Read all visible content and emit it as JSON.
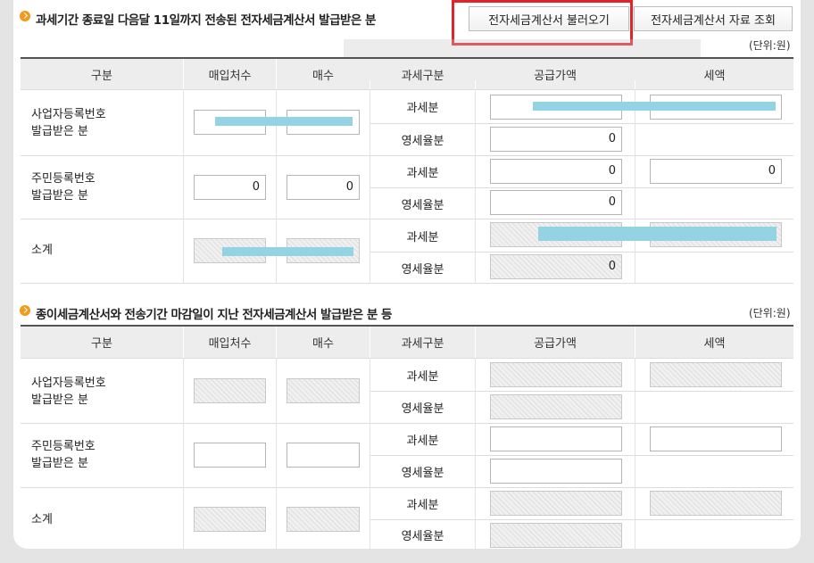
{
  "section1": {
    "title": "과세기간 종료일 다음달 11일까지 전송된 전자세금계산서 발급받은 분",
    "load_button": "전자세금계산서 불러오기",
    "view_button": "전자세금계산서 자료 조회",
    "unit": "(단위:원)",
    "headers": [
      "구분",
      "매입처수",
      "매수",
      "과세구분",
      "공급가액",
      "세액"
    ],
    "rows": [
      {
        "label_line1": "사업자등록번호",
        "label_line2": "발급받은 분",
        "suppliers": "",
        "count": "",
        "taxable_label": "과세분",
        "taxable_supply": "",
        "taxable_tax": "",
        "zero_label": "영세율분",
        "zero_supply": "0"
      },
      {
        "label_line1": "주민등록번호",
        "label_line2": "발급받은 분",
        "suppliers": "0",
        "count": "0",
        "taxable_label": "과세분",
        "taxable_supply": "0",
        "taxable_tax": "0",
        "zero_label": "영세율분",
        "zero_supply": "0"
      },
      {
        "label_line1": "소계",
        "label_line2": "",
        "suppliers": "",
        "count": "",
        "taxable_label": "과세분",
        "taxable_supply": "",
        "taxable_tax": "",
        "zero_label": "영세율분",
        "zero_supply": "0"
      }
    ]
  },
  "section2": {
    "title": "종이세금계산서와 전송기간 마감일이 지난 전자세금계산서 발급받은 분 등",
    "unit": "(단위:원)",
    "headers": [
      "구분",
      "매입처수",
      "매수",
      "과세구분",
      "공급가액",
      "세액"
    ],
    "rows": [
      {
        "label_line1": "사업자등록번호",
        "label_line2": "발급받은 분",
        "taxable_label": "과세분",
        "zero_label": "영세율분"
      },
      {
        "label_line1": "주민등록번호",
        "label_line2": "발급받은 분",
        "taxable_label": "과세분",
        "zero_label": "영세율분"
      },
      {
        "label_line1": "소계",
        "label_line2": "",
        "taxable_label": "과세분",
        "zero_label": "영세율분"
      }
    ]
  },
  "colors": {
    "highlight_border": "#e0242a",
    "bullet": "#f29a1b",
    "redaction": "#94d3e4"
  }
}
